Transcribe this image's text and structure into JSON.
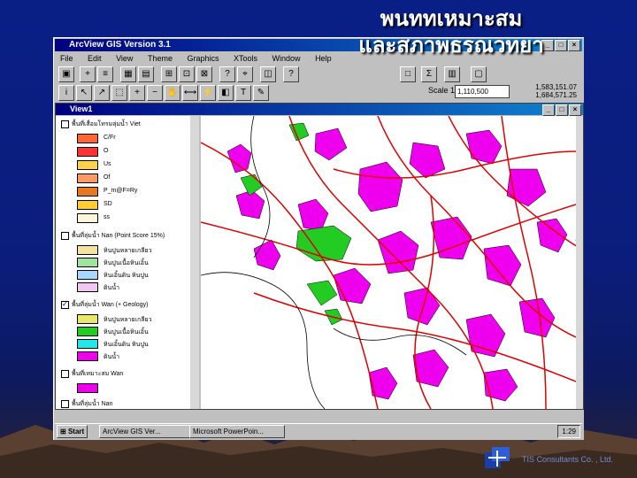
{
  "slide": {
    "title_line1": "พนททเหมาะสม",
    "title_line2": "และสภาพธรณวทยา",
    "footer": "TIS Consultants Co. , Ltd."
  },
  "app": {
    "title": "ArcView GIS Version 3.1",
    "menus": [
      "File",
      "Edit",
      "View",
      "Theme",
      "Graphics",
      "XTools",
      "Window",
      "Help"
    ],
    "scale_label": "Scale 1:",
    "scale_value": "1,110,500",
    "coord_x": "1,583,151.07",
    "coord_y": "1,684,571.25"
  },
  "view": {
    "title": "View1",
    "themes": [
      {
        "label": "พื้นที่เสื่อมโทรมลุ่มน้ำ Viet",
        "checked": false,
        "classes": [
          {
            "label": "C/Fr",
            "color": "#ff6633"
          },
          {
            "label": "O",
            "color": "#ff3333"
          },
          {
            "label": "Us",
            "color": "#ffd24d"
          },
          {
            "label": "Of",
            "color": "#ff9966"
          },
          {
            "label": "P_m@F=Ry",
            "color": "#e87722"
          },
          {
            "label": "SD",
            "color": "#ffcc33"
          },
          {
            "label": "ss",
            "color": "#fff8d8"
          }
        ]
      },
      {
        "label": "พื้นที่ลุ่มน้ำ Nan (Point Score 15%)",
        "checked": false,
        "classes": [
          {
            "label": "หินปูนหลายเกลียว",
            "color": "#f5e3a0"
          },
          {
            "label": "หินปูนเนื้อหินเอิ้น",
            "color": "#9ee59e"
          },
          {
            "label": "หินเอิ้นดิน หินปูน",
            "color": "#a8d8ff"
          },
          {
            "label": "ดินน้ำ",
            "color": "#f0c8f0"
          }
        ]
      },
      {
        "label": "พื้นที่ลุ่มน้ำ Wan (+ Geology)",
        "checked": true,
        "classes": [
          {
            "label": "หินปูนหลายเกลียว",
            "color": "#e8e86a"
          },
          {
            "label": "หินปูนเนื้อหินเอิ้น",
            "color": "#22cc22"
          },
          {
            "label": "หินเอิ้นดิน หินปูน",
            "color": "#22e8e8"
          },
          {
            "label": "ดินน้ำ",
            "color": "#ee00ee"
          }
        ]
      },
      {
        "label": "พื้นที่เหมาะสม Wan",
        "checked": false,
        "classes": [
          {
            "label": "",
            "color": "#ee00ee"
          }
        ]
      },
      {
        "label": "พื้นที่ลุ่มน้ำ Nan",
        "checked": false,
        "classes": []
      }
    ]
  },
  "taskbar": {
    "start": "Start",
    "tasks": [
      "ArcView GIS Ver...",
      "Microsoft PowerPoin..."
    ],
    "clock": "1:29"
  },
  "colors": {
    "slide_bg": "#0b1d7c",
    "magenta": "#ee00ee",
    "green": "#22cc22",
    "red": "#e00000",
    "win_gray": "#c0c0c0"
  }
}
